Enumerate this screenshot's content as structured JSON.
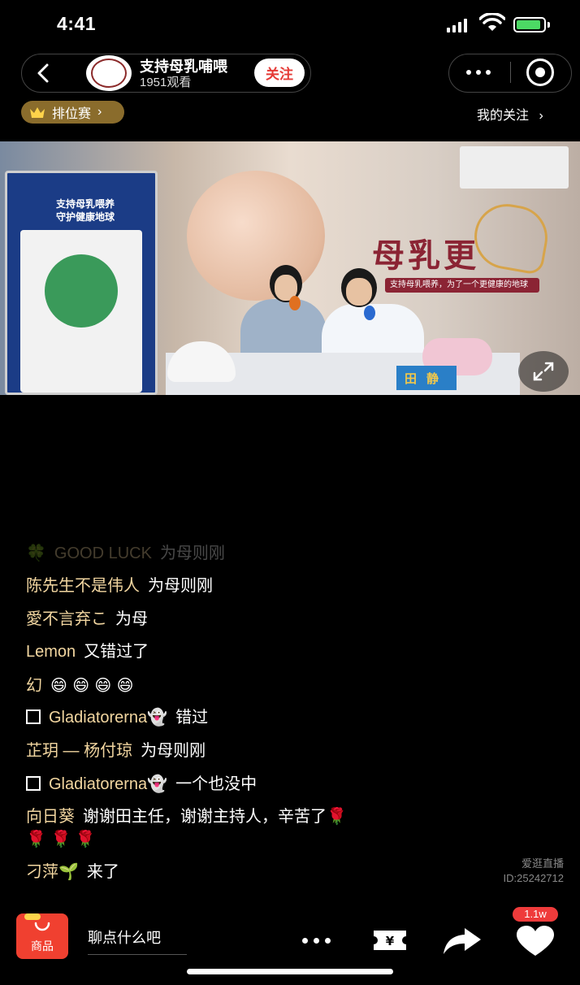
{
  "status_bar": {
    "time": "4:41"
  },
  "host": {
    "name": "支持母乳哺喂",
    "viewers": "1951观看",
    "follow_label": "关注"
  },
  "rank": {
    "label": "排位赛"
  },
  "my_follow": "我的关注",
  "video": {
    "brand_text": "母乳更",
    "strip_text": "支持母乳喂养，为了一个更健康的地球",
    "banner_title": "支持母乳喂养\n守护健康地球",
    "nameplate": "田静"
  },
  "chat": [
    {
      "user": "GOOD LUCK",
      "msg": "为母则刚",
      "prefix": "🍀",
      "faded": true
    },
    {
      "user": "陈先生不是伟人",
      "msg": "为母则刚"
    },
    {
      "user": "愛不言弃こ",
      "msg": "为母"
    },
    {
      "user": "Lemon",
      "msg": "又错过了"
    },
    {
      "user": "幻",
      "msg": "😄 😄 😄 😄"
    },
    {
      "user": "Gladiatorerna👻",
      "msg": "错过",
      "box": true
    },
    {
      "user": "芷玥 — 杨付琼",
      "msg": "为母则刚"
    },
    {
      "user": "Gladiatorerna👻",
      "msg": "一个也没中",
      "box": true
    },
    {
      "user": "向日葵",
      "msg": "谢谢田主任，谢谢主持人，辛苦了🌹",
      "cont": "🌹 🌹 🌹"
    },
    {
      "user": "刁萍🌱",
      "msg": "来了"
    }
  ],
  "watermark": {
    "platform": "爱逛直播",
    "id": "ID:25242712"
  },
  "bottom": {
    "goods_label": "商品",
    "chat_placeholder": "聊点什么吧",
    "like_count": "1.1w"
  },
  "colors": {
    "follow_text": "#e53935",
    "username": "#f2d6a0",
    "rank_bg": "#8a6c2c",
    "goods_bg": "#f04030",
    "like_badge": "#ef3b3b"
  },
  "icons": [
    "back-icon",
    "avatar",
    "more-icon",
    "close-icon",
    "crown-icon",
    "expand-icon",
    "bag-icon",
    "tip-icon",
    "share-icon",
    "heart-icon"
  ]
}
